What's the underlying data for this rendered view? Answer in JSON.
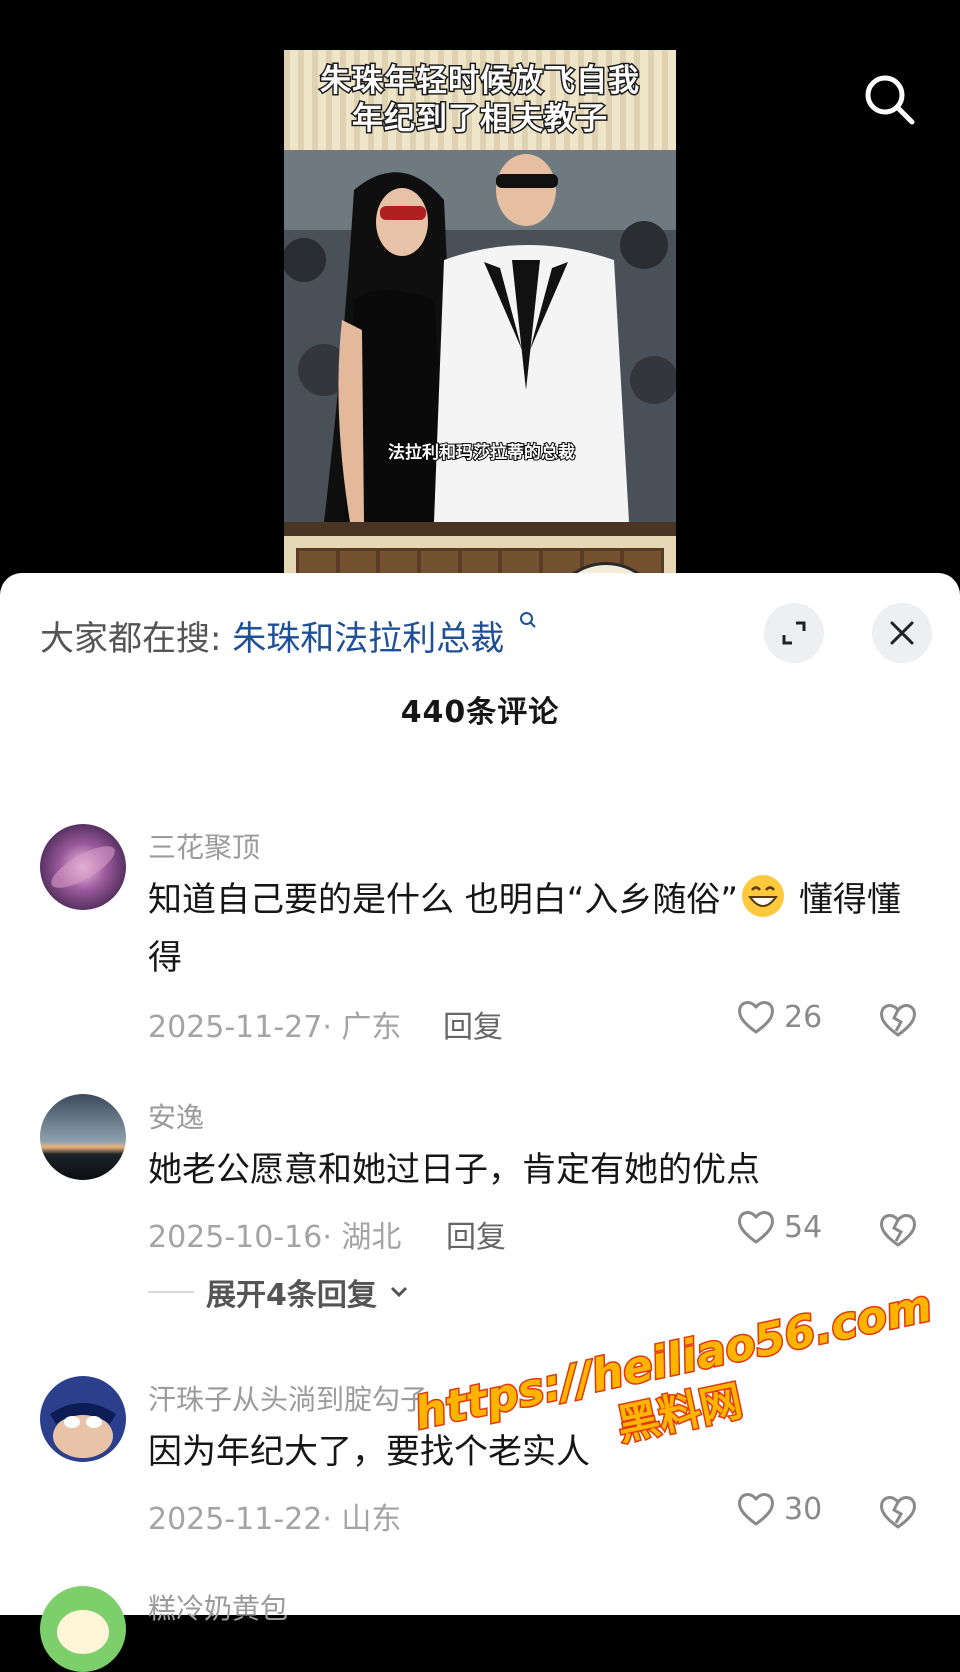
{
  "video": {
    "title_line1": "朱珠年轻时候放飞自我",
    "title_line2": "年纪到了相夫教子",
    "caption": "法拉利和玛莎拉蒂的总裁"
  },
  "sheet": {
    "trending_label": "大家都在搜:",
    "trending_term": "朱珠和法拉利总裁",
    "comment_count": "440条评论"
  },
  "comments": [
    {
      "username": "三花聚顶",
      "text_before_emoji": "知道自己要的是什么 也明白“入乡随俗”",
      "text_after_emoji": " 懂得懂得",
      "date": "2025-11-27",
      "location": "· 广东",
      "reply_label": "回复",
      "likes": "26"
    },
    {
      "username": "安逸",
      "text": "她老公愿意和她过日子，肯定有她的优点",
      "date": "2025-10-16",
      "location": "· 湖北",
      "reply_label": "回复",
      "likes": "54",
      "expand_replies": "展开4条回复"
    },
    {
      "username": "汗珠子从头淌到腚勾子",
      "text": "因为年纪大了，要找个老实人",
      "date": "2025-11-22",
      "location": "· 山东",
      "likes": "30"
    },
    {
      "username": "糕冷奶黄包"
    }
  ],
  "watermark": {
    "url": "https://heiliao56.com",
    "name": "黑料网"
  },
  "icons": {
    "search": "search-icon",
    "expand": "expand-icon",
    "close": "close-icon",
    "like": "heart-icon",
    "dislike": "broken-heart-icon",
    "emoji": "grinning-face-emoji"
  }
}
